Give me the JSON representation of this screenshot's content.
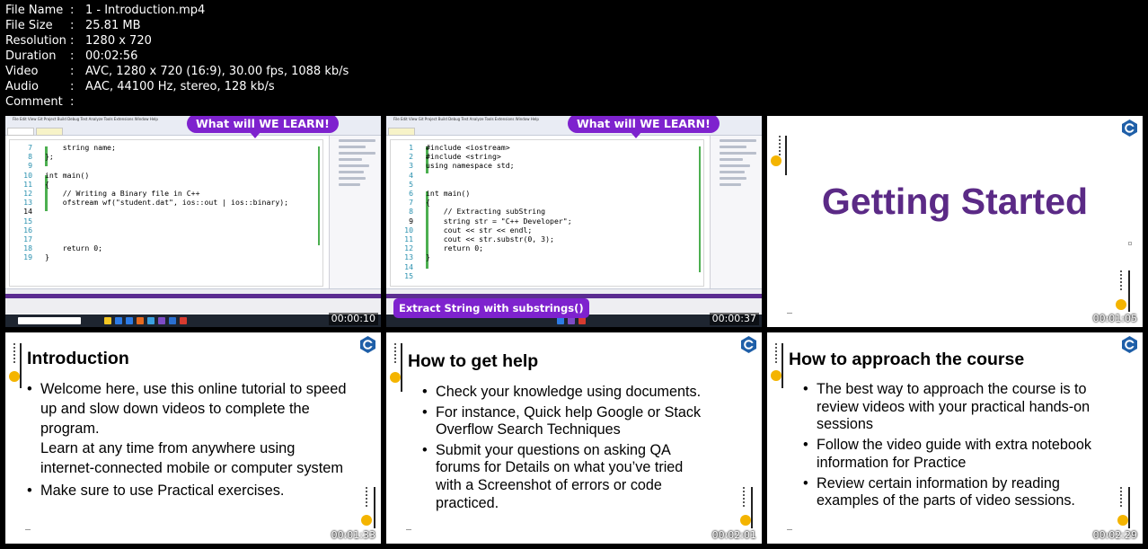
{
  "file_info": [
    {
      "key": "File Name",
      "value": "1 - Introduction.mp4"
    },
    {
      "key": "File Size",
      "value": "25.81 MB"
    },
    {
      "key": "Resolution",
      "value": "1280 x 720"
    },
    {
      "key": "Duration",
      "value": "00:02:56"
    },
    {
      "key": "Video",
      "value": "AVC, 1280 x 720 (16:9), 30.00 fps, 1088 kb/s"
    },
    {
      "key": "Audio",
      "value": "AAC, 44100 Hz, stereo, 128 kb/s"
    },
    {
      "key": "Comment",
      "value": ""
    }
  ],
  "separator": ":",
  "thumbnails": [
    {
      "timestamp": "00:00:10",
      "callout": "What will WE LEARN!",
      "code": [
        {
          "n": "7",
          "text": "    string name;"
        },
        {
          "n": "8",
          "text": "};"
        },
        {
          "n": "9",
          "text": ""
        },
        {
          "n": "10",
          "text": "int main()"
        },
        {
          "n": "11",
          "text": "{"
        },
        {
          "n": "12",
          "text": "    // Writing a Binary file in C++"
        },
        {
          "n": "13",
          "text": "    ofstream wf(\"student.dat\", ios::out | ios::binary);"
        },
        {
          "n": "14",
          "text": ""
        },
        {
          "n": "15",
          "text": ""
        },
        {
          "n": "16",
          "text": ""
        },
        {
          "n": "17",
          "text": ""
        },
        {
          "n": "18",
          "text": "    return 0;"
        },
        {
          "n": "19",
          "text": "}"
        }
      ]
    },
    {
      "timestamp": "00:00:37",
      "callout": "What will WE LEARN!",
      "label": "Extract String with substrings()",
      "code": [
        {
          "n": "1",
          "text": "#include <iostream>"
        },
        {
          "n": "2",
          "text": "#include <string>"
        },
        {
          "n": "3",
          "text": "using namespace std;"
        },
        {
          "n": "4",
          "text": ""
        },
        {
          "n": "5",
          "text": ""
        },
        {
          "n": "6",
          "text": "int main()"
        },
        {
          "n": "7",
          "text": "{"
        },
        {
          "n": "8",
          "text": "    // Extracting subString"
        },
        {
          "n": "9",
          "text": "    string str = \"C++ Developer\";"
        },
        {
          "n": "10",
          "text": "    cout << str << endl;"
        },
        {
          "n": "11",
          "text": "    cout << str.substr(0, 3);"
        },
        {
          "n": "12",
          "text": "    return 0;"
        },
        {
          "n": "13",
          "text": "}"
        },
        {
          "n": "14",
          "text": ""
        },
        {
          "n": "15",
          "text": ""
        }
      ]
    },
    {
      "timestamp": "00:01:05",
      "heading": "Getting Started"
    },
    {
      "timestamp": "00:01:33",
      "title": "Introduction",
      "bullets": [
        {
          "text": "Welcome here, use this online tutorial to speed",
          "bullet": true
        },
        {
          "text": "up and slow down videos to complete the",
          "bullet": false
        },
        {
          "text": "program.",
          "bullet": false
        },
        {
          "text": "Learn at any time from anywhere using",
          "bullet": false
        },
        {
          "text": "internet-connected mobile or computer system",
          "bullet": false
        },
        {
          "text": "Make sure to use Practical exercises.",
          "bullet": true
        }
      ]
    },
    {
      "timestamp": "00:02:01",
      "title": "How to get help",
      "bullets": [
        {
          "text": "Check your knowledge using documents.",
          "bullet": true
        },
        {
          "text": "For instance, Quick help Google or Stack",
          "bullet": true
        },
        {
          "text": "Overflow Search Techniques",
          "bullet": false
        },
        {
          "text": "Submit your questions on asking QA",
          "bullet": true
        },
        {
          "text": "forums for Details on what you’ve tried",
          "bullet": false
        },
        {
          "text": "with a Screenshot of errors or code",
          "bullet": false
        },
        {
          "text": "practiced.",
          "bullet": false
        }
      ]
    },
    {
      "timestamp": "00:02:29",
      "title": "How to approach the course",
      "bullets": [
        {
          "text": "The best way to approach the course is to",
          "bullet": true
        },
        {
          "text": "review videos with your practical hands-on",
          "bullet": false
        },
        {
          "text": "sessions",
          "bullet": false
        },
        {
          "text": "Follow the video guide with extra notebook",
          "bullet": true
        },
        {
          "text": "information for Practice",
          "bullet": false
        },
        {
          "text": "Review certain information by reading",
          "bullet": true
        },
        {
          "text": "examples of the parts of video sessions.",
          "bullet": false
        }
      ]
    }
  ],
  "colors": {
    "accent_purple": "#7e22ce",
    "title_purple": "#5b2a86",
    "slide_yellow": "#f4b400",
    "logo_blue": "#1f5fa8"
  }
}
